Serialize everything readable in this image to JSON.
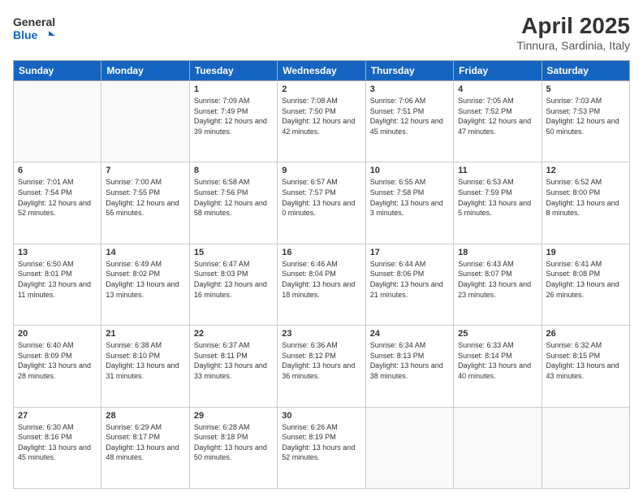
{
  "header": {
    "logo_line1": "General",
    "logo_line2": "Blue",
    "main_title": "April 2025",
    "subtitle": "Tinnura, Sardinia, Italy"
  },
  "weekdays": [
    "Sunday",
    "Monday",
    "Tuesday",
    "Wednesday",
    "Thursday",
    "Friday",
    "Saturday"
  ],
  "weeks": [
    [
      {
        "day": "",
        "info": ""
      },
      {
        "day": "",
        "info": ""
      },
      {
        "day": "1",
        "info": "Sunrise: 7:09 AM\nSunset: 7:49 PM\nDaylight: 12 hours and 39 minutes."
      },
      {
        "day": "2",
        "info": "Sunrise: 7:08 AM\nSunset: 7:50 PM\nDaylight: 12 hours and 42 minutes."
      },
      {
        "day": "3",
        "info": "Sunrise: 7:06 AM\nSunset: 7:51 PM\nDaylight: 12 hours and 45 minutes."
      },
      {
        "day": "4",
        "info": "Sunrise: 7:05 AM\nSunset: 7:52 PM\nDaylight: 12 hours and 47 minutes."
      },
      {
        "day": "5",
        "info": "Sunrise: 7:03 AM\nSunset: 7:53 PM\nDaylight: 12 hours and 50 minutes."
      }
    ],
    [
      {
        "day": "6",
        "info": "Sunrise: 7:01 AM\nSunset: 7:54 PM\nDaylight: 12 hours and 52 minutes."
      },
      {
        "day": "7",
        "info": "Sunrise: 7:00 AM\nSunset: 7:55 PM\nDaylight: 12 hours and 55 minutes."
      },
      {
        "day": "8",
        "info": "Sunrise: 6:58 AM\nSunset: 7:56 PM\nDaylight: 12 hours and 58 minutes."
      },
      {
        "day": "9",
        "info": "Sunrise: 6:57 AM\nSunset: 7:57 PM\nDaylight: 13 hours and 0 minutes."
      },
      {
        "day": "10",
        "info": "Sunrise: 6:55 AM\nSunset: 7:58 PM\nDaylight: 13 hours and 3 minutes."
      },
      {
        "day": "11",
        "info": "Sunrise: 6:53 AM\nSunset: 7:59 PM\nDaylight: 13 hours and 5 minutes."
      },
      {
        "day": "12",
        "info": "Sunrise: 6:52 AM\nSunset: 8:00 PM\nDaylight: 13 hours and 8 minutes."
      }
    ],
    [
      {
        "day": "13",
        "info": "Sunrise: 6:50 AM\nSunset: 8:01 PM\nDaylight: 13 hours and 11 minutes."
      },
      {
        "day": "14",
        "info": "Sunrise: 6:49 AM\nSunset: 8:02 PM\nDaylight: 13 hours and 13 minutes."
      },
      {
        "day": "15",
        "info": "Sunrise: 6:47 AM\nSunset: 8:03 PM\nDaylight: 13 hours and 16 minutes."
      },
      {
        "day": "16",
        "info": "Sunrise: 6:46 AM\nSunset: 8:04 PM\nDaylight: 13 hours and 18 minutes."
      },
      {
        "day": "17",
        "info": "Sunrise: 6:44 AM\nSunset: 8:06 PM\nDaylight: 13 hours and 21 minutes."
      },
      {
        "day": "18",
        "info": "Sunrise: 6:43 AM\nSunset: 8:07 PM\nDaylight: 13 hours and 23 minutes."
      },
      {
        "day": "19",
        "info": "Sunrise: 6:41 AM\nSunset: 8:08 PM\nDaylight: 13 hours and 26 minutes."
      }
    ],
    [
      {
        "day": "20",
        "info": "Sunrise: 6:40 AM\nSunset: 8:09 PM\nDaylight: 13 hours and 28 minutes."
      },
      {
        "day": "21",
        "info": "Sunrise: 6:38 AM\nSunset: 8:10 PM\nDaylight: 13 hours and 31 minutes."
      },
      {
        "day": "22",
        "info": "Sunrise: 6:37 AM\nSunset: 8:11 PM\nDaylight: 13 hours and 33 minutes."
      },
      {
        "day": "23",
        "info": "Sunrise: 6:36 AM\nSunset: 8:12 PM\nDaylight: 13 hours and 36 minutes."
      },
      {
        "day": "24",
        "info": "Sunrise: 6:34 AM\nSunset: 8:13 PM\nDaylight: 13 hours and 38 minutes."
      },
      {
        "day": "25",
        "info": "Sunrise: 6:33 AM\nSunset: 8:14 PM\nDaylight: 13 hours and 40 minutes."
      },
      {
        "day": "26",
        "info": "Sunrise: 6:32 AM\nSunset: 8:15 PM\nDaylight: 13 hours and 43 minutes."
      }
    ],
    [
      {
        "day": "27",
        "info": "Sunrise: 6:30 AM\nSunset: 8:16 PM\nDaylight: 13 hours and 45 minutes."
      },
      {
        "day": "28",
        "info": "Sunrise: 6:29 AM\nSunset: 8:17 PM\nDaylight: 13 hours and 48 minutes."
      },
      {
        "day": "29",
        "info": "Sunrise: 6:28 AM\nSunset: 8:18 PM\nDaylight: 13 hours and 50 minutes."
      },
      {
        "day": "30",
        "info": "Sunrise: 6:26 AM\nSunset: 8:19 PM\nDaylight: 13 hours and 52 minutes."
      },
      {
        "day": "",
        "info": ""
      },
      {
        "day": "",
        "info": ""
      },
      {
        "day": "",
        "info": ""
      }
    ]
  ]
}
